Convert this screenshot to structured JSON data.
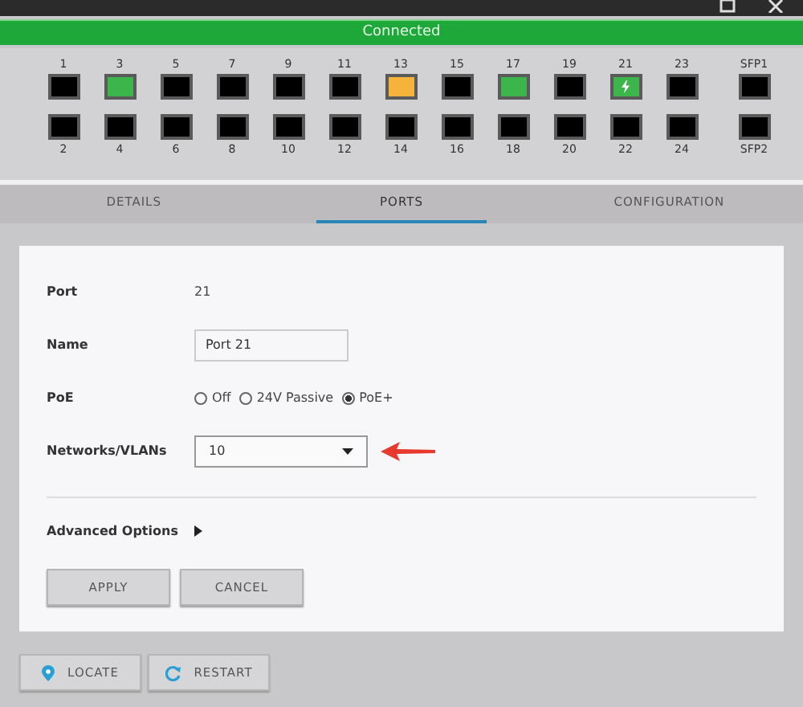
{
  "status_bar": {
    "text": "Connected"
  },
  "ports": {
    "top_row": [
      {
        "label": "1",
        "color": "#000000",
        "poe": false
      },
      {
        "label": "3",
        "color": "#3cb54a",
        "poe": false
      },
      {
        "label": "5",
        "color": "#000000",
        "poe": false
      },
      {
        "label": "7",
        "color": "#000000",
        "poe": false
      },
      {
        "label": "9",
        "color": "#000000",
        "poe": false
      },
      {
        "label": "11",
        "color": "#000000",
        "poe": false
      },
      {
        "label": "13",
        "color": "#f6b33c",
        "poe": false
      },
      {
        "label": "15",
        "color": "#000000",
        "poe": false
      },
      {
        "label": "17",
        "color": "#3cb54a",
        "poe": false
      },
      {
        "label": "19",
        "color": "#000000",
        "poe": false
      },
      {
        "label": "21",
        "color": "#3cb54a",
        "poe": true
      },
      {
        "label": "23",
        "color": "#000000",
        "poe": false
      },
      {
        "label": "SFP1",
        "color": "#000000",
        "poe": false
      }
    ],
    "bottom_row": [
      {
        "label": "2",
        "color": "#000000",
        "poe": false
      },
      {
        "label": "4",
        "color": "#000000",
        "poe": false
      },
      {
        "label": "6",
        "color": "#000000",
        "poe": false
      },
      {
        "label": "8",
        "color": "#000000",
        "poe": false
      },
      {
        "label": "10",
        "color": "#000000",
        "poe": false
      },
      {
        "label": "12",
        "color": "#000000",
        "poe": false
      },
      {
        "label": "14",
        "color": "#000000",
        "poe": false
      },
      {
        "label": "16",
        "color": "#000000",
        "poe": false
      },
      {
        "label": "18",
        "color": "#000000",
        "poe": false
      },
      {
        "label": "20",
        "color": "#000000",
        "poe": false
      },
      {
        "label": "22",
        "color": "#000000",
        "poe": false
      },
      {
        "label": "24",
        "color": "#000000",
        "poe": false
      },
      {
        "label": "SFP2",
        "color": "#000000",
        "poe": false
      }
    ]
  },
  "tabs": [
    {
      "label": "DETAILS",
      "selected": false
    },
    {
      "label": "PORTS",
      "selected": true
    },
    {
      "label": "CONFIGURATION",
      "selected": false
    }
  ],
  "form": {
    "port": {
      "label": "Port",
      "value": "21"
    },
    "name": {
      "label": "Name",
      "value": "Port 21"
    },
    "poe": {
      "label": "PoE",
      "options": [
        {
          "label": "Off",
          "selected": false
        },
        {
          "label": "24V Passive",
          "selected": false
        },
        {
          "label": "PoE+",
          "selected": true
        }
      ]
    },
    "vlan": {
      "label": "Networks/VLANs",
      "value": "10"
    },
    "advanced": {
      "label": "Advanced Options",
      "expanded": false
    },
    "buttons": [
      "APPLY",
      "CANCEL"
    ]
  },
  "footer_buttons": [
    {
      "kind": "locate",
      "label": "LOCATE"
    },
    {
      "kind": "restart",
      "label": "RESTART"
    }
  ]
}
